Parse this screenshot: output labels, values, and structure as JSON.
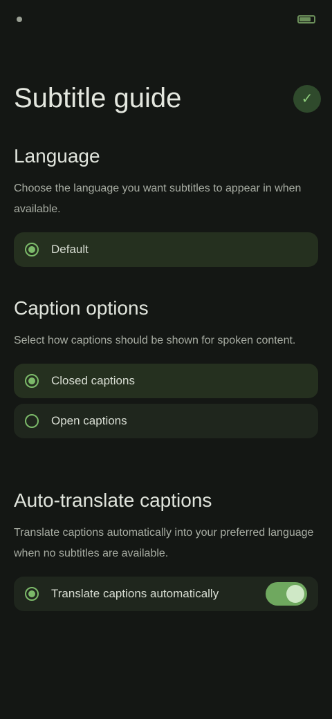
{
  "status_bar": {
    "time": "",
    "battery_level": 0.8
  },
  "header": {
    "title": "Subtitle guide",
    "action_icon": "check-icon"
  },
  "sections": {
    "language": {
      "title": "Language",
      "description": "Choose the language you want subtitles to appear in when available.",
      "option_label": "Default"
    },
    "caption_type": {
      "title": "Caption options",
      "description": "Select how captions should be shown for spoken content.",
      "options": [
        "Closed captions",
        "Open captions"
      ]
    },
    "auto_translate": {
      "title": "Auto-translate captions",
      "description": "Translate captions automatically into your preferred language when no subtitles are available.",
      "option_label": "Translate captions automatically",
      "toggle_on": true
    }
  },
  "colors": {
    "background": "#141714",
    "accent": "#7cba6a",
    "card": "#1f261d"
  }
}
